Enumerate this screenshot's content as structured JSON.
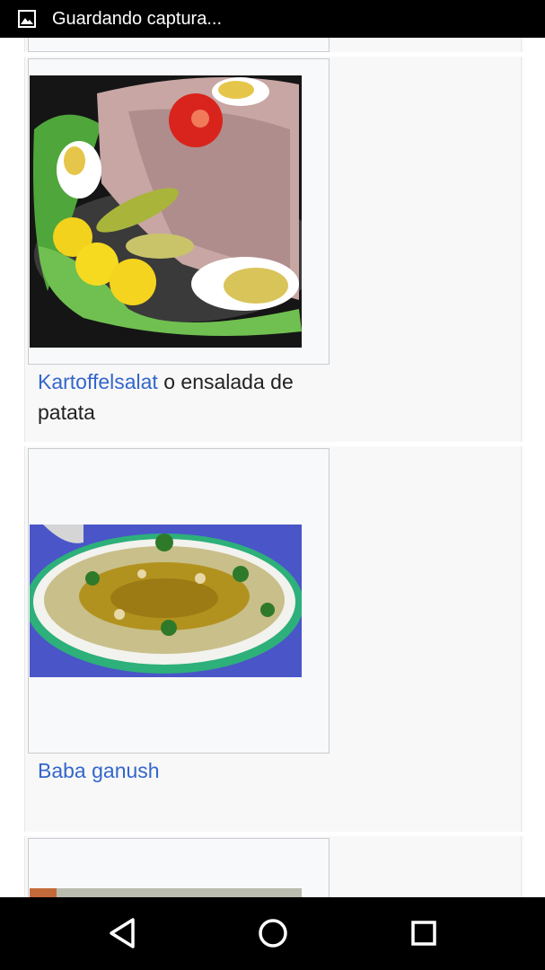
{
  "status_bar": {
    "notification_icon": "image-icon",
    "text": "Guardando captura..."
  },
  "gallery": {
    "items": [
      {
        "image_alt": "Kartoffelsalat",
        "link_label": "Kartoffelsalat",
        "caption_rest": " o ensalada de patata"
      },
      {
        "image_alt": "Baba ganush",
        "link_label": "Baba ganush",
        "caption_rest": ""
      }
    ]
  },
  "nav_bar": {
    "back_icon": "back-triangle-icon",
    "home_icon": "home-circle-icon",
    "recents_icon": "recents-square-icon"
  },
  "colors": {
    "link": "#3366cc",
    "text": "#222222",
    "bar": "#000000",
    "gallery_bg": "#f8f8f8"
  }
}
